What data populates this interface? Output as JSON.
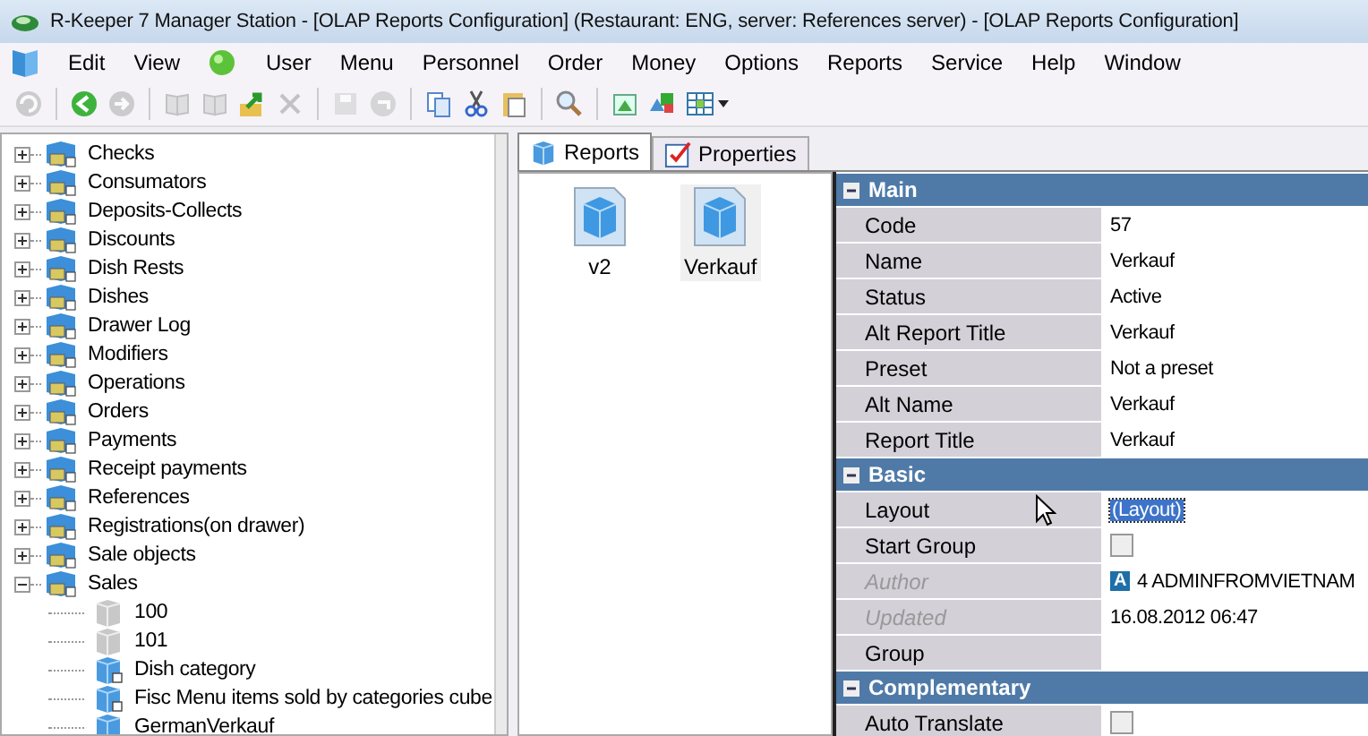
{
  "window": {
    "title": "R-Keeper 7 Manager Station - [OLAP Reports Configuration] (Restaurant: ENG, server: References server) - [OLAP Reports Configuration]"
  },
  "menu": [
    {
      "kind": "app"
    },
    {
      "label": "Edit"
    },
    {
      "label": "View"
    },
    {
      "kind": "status"
    },
    {
      "label": "User"
    },
    {
      "label": "Menu"
    },
    {
      "label": "Personnel"
    },
    {
      "label": "Order"
    },
    {
      "label": "Money"
    },
    {
      "label": "Options"
    },
    {
      "label": "Reports"
    },
    {
      "label": "Service"
    },
    {
      "label": "Help"
    },
    {
      "label": "Window"
    }
  ],
  "toolbar": [
    {
      "kind": "refresh",
      "disabled": true
    },
    {
      "kind": "sep"
    },
    {
      "kind": "back",
      "disabled": false
    },
    {
      "kind": "forward",
      "disabled": true
    },
    {
      "kind": "sep"
    },
    {
      "kind": "book",
      "disabled": true
    },
    {
      "kind": "book",
      "disabled": true
    },
    {
      "kind": "export",
      "disabled": false
    },
    {
      "kind": "delete",
      "disabled": true
    },
    {
      "kind": "sep"
    },
    {
      "kind": "save",
      "disabled": true
    },
    {
      "kind": "undo",
      "disabled": true
    },
    {
      "kind": "sep"
    },
    {
      "kind": "copy",
      "disabled": false
    },
    {
      "kind": "cut",
      "disabled": false
    },
    {
      "kind": "paste",
      "disabled": false
    },
    {
      "kind": "sep"
    },
    {
      "kind": "search",
      "disabled": false
    },
    {
      "kind": "sep"
    },
    {
      "kind": "image",
      "disabled": false
    },
    {
      "kind": "shapes",
      "disabled": false
    },
    {
      "kind": "grid",
      "disabled": false
    }
  ],
  "tree": [
    {
      "label": "Checks",
      "expanded": false
    },
    {
      "label": "Consumators",
      "expanded": false
    },
    {
      "label": "Deposits-Collects",
      "expanded": false
    },
    {
      "label": "Discounts",
      "expanded": false
    },
    {
      "label": "Dish Rests",
      "expanded": false
    },
    {
      "label": "Dishes",
      "expanded": false
    },
    {
      "label": "Drawer Log",
      "expanded": false
    },
    {
      "label": "Modifiers",
      "expanded": false
    },
    {
      "label": "Operations",
      "expanded": false
    },
    {
      "label": "Orders",
      "expanded": false
    },
    {
      "label": "Payments",
      "expanded": false
    },
    {
      "label": "Receipt payments",
      "expanded": false
    },
    {
      "label": "References",
      "expanded": false
    },
    {
      "label": "Registrations(on drawer)",
      "expanded": false
    },
    {
      "label": "Sale objects",
      "expanded": false
    },
    {
      "label": "Sales",
      "expanded": true,
      "children": [
        {
          "label": "100",
          "kind": "inactive"
        },
        {
          "label": "101",
          "kind": "inactive"
        },
        {
          "label": "Dish category",
          "kind": "linked"
        },
        {
          "label": "Fisc Menu items sold by categories cube",
          "kind": "linked"
        },
        {
          "label": "GermanVerkauf",
          "kind": "plain"
        }
      ]
    }
  ],
  "tabs": [
    {
      "label": "Reports",
      "kind": "cube",
      "selected": true
    },
    {
      "label": "Properties",
      "kind": "check",
      "selected": false
    }
  ],
  "reports": [
    {
      "label": "v2",
      "selected": false
    },
    {
      "label": "Verkauf",
      "selected": true
    }
  ],
  "properties": [
    {
      "title": "Main",
      "rows": [
        {
          "name": "Code",
          "value": "57"
        },
        {
          "name": "Name",
          "value": "Verkauf"
        },
        {
          "name": "Status",
          "value": "Active"
        },
        {
          "name": "Alt Report Title",
          "value": "Verkauf"
        },
        {
          "name": "Preset",
          "value": "Not a preset"
        },
        {
          "name": "Alt Name",
          "value": "Verkauf"
        },
        {
          "name": "Report Title",
          "value": "Verkauf"
        }
      ]
    },
    {
      "title": "Basic",
      "rows": [
        {
          "name": "Layout",
          "value": "(Layout)",
          "selected": true
        },
        {
          "name": "Start Group",
          "kind": "checkbox",
          "checked": false
        },
        {
          "name": "Author",
          "value": "4 ADMINFROMVIETNAM",
          "badge": "A",
          "disabled": true
        },
        {
          "name": "Updated",
          "value": "16.08.2012 06:47",
          "disabled": true
        },
        {
          "name": "Group",
          "value": ""
        }
      ]
    },
    {
      "title": "Complementary",
      "rows": [
        {
          "name": "Auto Translate",
          "kind": "checkbox",
          "checked": false
        }
      ]
    }
  ]
}
